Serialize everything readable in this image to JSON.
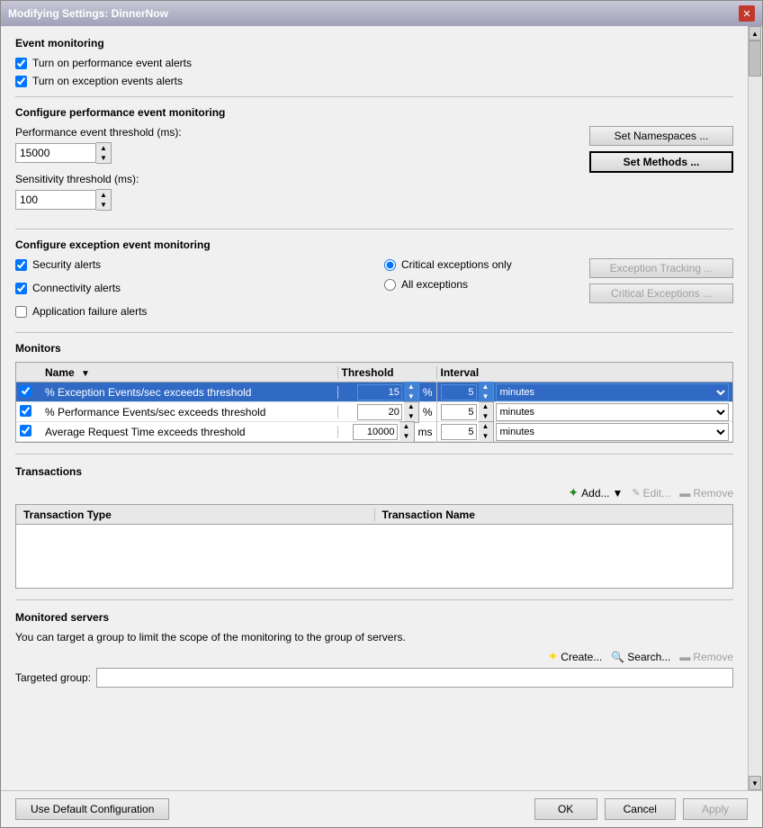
{
  "window": {
    "title": "Modifying Settings: DinnerNow"
  },
  "event_monitoring": {
    "title": "Event monitoring",
    "check1_label": "Turn on performance event alerts",
    "check2_label": "Turn on exception events alerts",
    "check1_checked": true,
    "check2_checked": true
  },
  "perf_config": {
    "title": "Configure performance event monitoring",
    "perf_threshold_label": "Performance event threshold (ms):",
    "perf_threshold_value": "15000",
    "sensitivity_label": "Sensitivity threshold (ms):",
    "sensitivity_value": "100",
    "btn_namespaces": "Set Namespaces ...",
    "btn_methods": "Set Methods ..."
  },
  "exception_config": {
    "title": "Configure exception event monitoring",
    "check_security": "Security alerts",
    "check_connectivity": "Connectivity alerts",
    "check_appfailure": "Application failure alerts",
    "radio_critical": "Critical exceptions only",
    "radio_all": "All exceptions",
    "btn_exception_tracking": "Exception Tracking ...",
    "btn_critical_exceptions": "Critical Exceptions ..."
  },
  "monitors": {
    "title": "Monitors",
    "columns": [
      "Name",
      "Threshold",
      "Interval"
    ],
    "rows": [
      {
        "checked": true,
        "name": "% Exception Events/sec exceeds threshold",
        "threshold": "15",
        "threshold_unit": "%",
        "interval": "5",
        "interval_unit": "minutes",
        "selected": true
      },
      {
        "checked": true,
        "name": "% Performance Events/sec exceeds threshold",
        "threshold": "20",
        "threshold_unit": "%",
        "interval": "5",
        "interval_unit": "minutes",
        "selected": false
      },
      {
        "checked": true,
        "name": "Average Request Time exceeds threshold",
        "threshold": "10000",
        "threshold_unit": "ms",
        "interval": "5",
        "interval_unit": "minutes",
        "selected": false
      }
    ]
  },
  "transactions": {
    "title": "Transactions",
    "btn_add": "Add...",
    "btn_edit": "Edit...",
    "btn_remove": "Remove",
    "col_type": "Transaction Type",
    "col_name": "Transaction Name"
  },
  "monitored_servers": {
    "title": "Monitored servers",
    "description": "You can target a group to limit the scope of the monitoring to the group of servers.",
    "targeted_label": "Targeted group:",
    "btn_create": "Create...",
    "btn_search": "Search...",
    "btn_remove": "Remove"
  },
  "footer": {
    "btn_default": "Use Default Configuration",
    "btn_ok": "OK",
    "btn_cancel": "Cancel",
    "btn_apply": "Apply"
  }
}
